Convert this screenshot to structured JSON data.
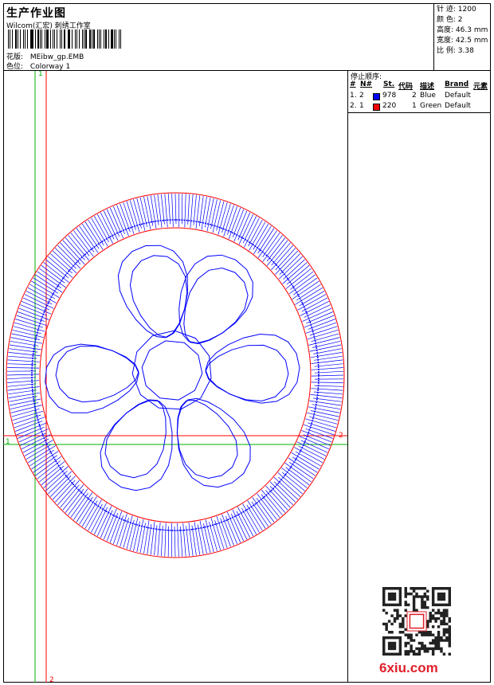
{
  "header": {
    "title": "生产作业图",
    "subtitle": "Wilcom(汇宏) 刺绣工作室",
    "file_label": "花版:",
    "file_name": "MEibw_gp.EMB",
    "colorway_label": "色位:",
    "colorway_name": "Colorway 1"
  },
  "stats": [
    {
      "label": "针 迹:",
      "value": "1200"
    },
    {
      "label": "颜 色:",
      "value": "2"
    },
    {
      "label": "高度:",
      "value": "46.3 mm"
    },
    {
      "label": "宽度:",
      "value": "42.5 mm"
    },
    {
      "label": "比 例:",
      "value": "3.38"
    }
  ],
  "stop_sequence": {
    "title": "停止顺序:",
    "columns": [
      "#",
      "N#",
      "St.",
      "代码",
      "描述",
      "Brand",
      "元素"
    ],
    "rows": [
      {
        "idx": "1.",
        "n": "2",
        "color": "#0000ff",
        "st": "978",
        "code": "2",
        "desc": "Blue",
        "brand": "Default"
      },
      {
        "idx": "2.",
        "n": "1",
        "color": "#ff0000",
        "st": "220",
        "code": "1",
        "desc": "Green",
        "brand": "Default"
      }
    ]
  },
  "guides": {
    "vertical_green_label": "1",
    "vertical_red_label": "2",
    "horizontal_green_label": "1",
    "horizontal_red_label": "2"
  },
  "colors": {
    "stitch_blue": "#0000ff",
    "guide_red": "#ff0000",
    "guide_green": "#00b000",
    "watermark_red": "#e0202a"
  },
  "watermark": {
    "text": "6xiu.com",
    "icon": "qr-code-icon"
  }
}
